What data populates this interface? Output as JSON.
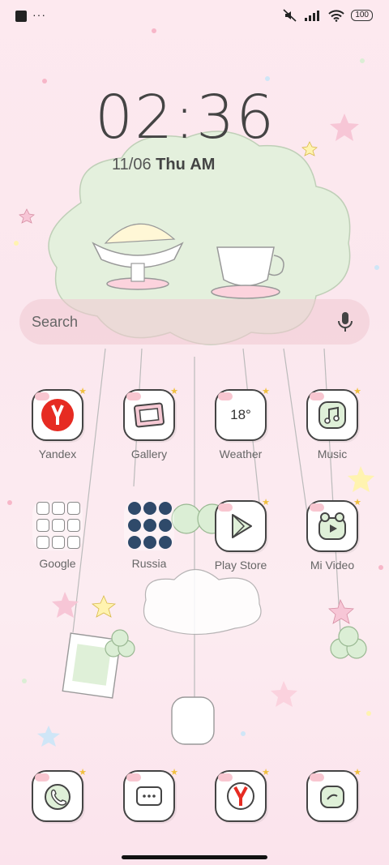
{
  "status_bar": {
    "battery": "100",
    "dots": "···"
  },
  "clock": {
    "time": "02:36",
    "date": "11/06",
    "weekday": "Thu",
    "ampm": "AM"
  },
  "search": {
    "placeholder": "Search"
  },
  "apps_row1": [
    {
      "label": "Yandex",
      "icon": "yandex-icon"
    },
    {
      "label": "Gallery",
      "icon": "gallery-icon"
    },
    {
      "label": "Weather",
      "icon": "weather-icon",
      "value": "18°"
    },
    {
      "label": "Music",
      "icon": "music-icon"
    }
  ],
  "apps_row2": [
    {
      "label": "Google",
      "icon": "folder-icon"
    },
    {
      "label": "Russia",
      "icon": "folder-icon"
    },
    {
      "label": "Play Store",
      "icon": "play-store-icon"
    },
    {
      "label": "Mi Video",
      "icon": "mi-video-icon"
    }
  ],
  "dock": [
    {
      "icon": "phone-icon"
    },
    {
      "icon": "messages-icon"
    },
    {
      "icon": "yandex-browser-icon"
    },
    {
      "icon": "security-icon"
    }
  ],
  "colors": {
    "accent_pink": "#f8c6d0",
    "yandex_red": "#e62b22",
    "mint": "#dff0d8"
  }
}
